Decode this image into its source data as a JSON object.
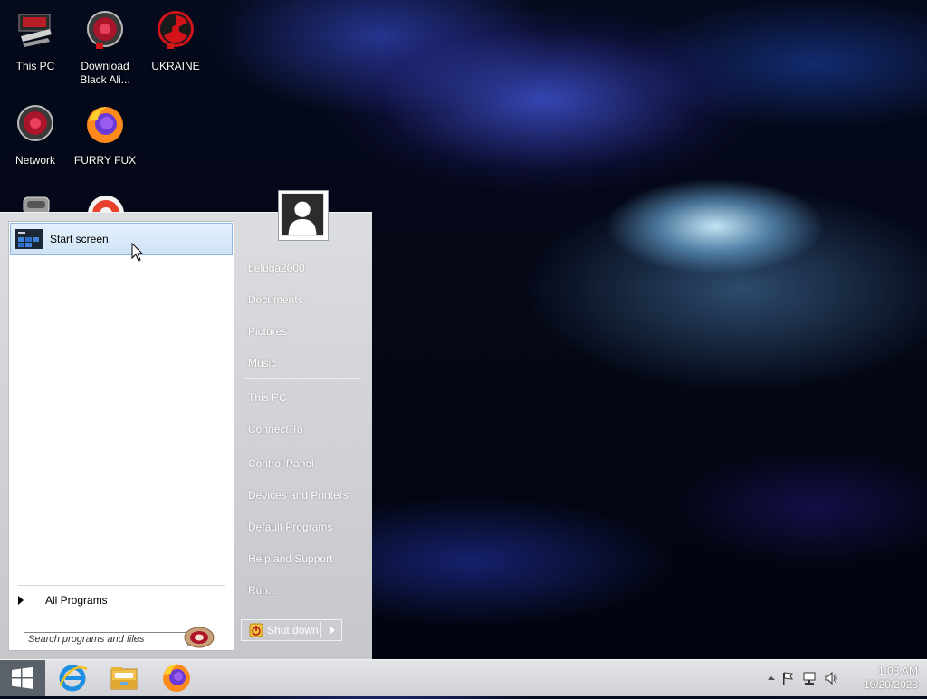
{
  "desktop": {
    "icons": [
      {
        "label": "This PC",
        "icon": "this-pc-icon"
      },
      {
        "label": "Download Black Ali...",
        "icon": "download-black-alien-icon"
      },
      {
        "label": "UKRAINE",
        "icon": "radiation-icon"
      },
      {
        "label": "Network",
        "icon": "network-icon"
      },
      {
        "label": "FURRY FUX",
        "icon": "firefox-icon"
      }
    ]
  },
  "start_menu": {
    "pinned": [
      {
        "label": "Start screen",
        "icon": "start-screen-icon"
      }
    ],
    "all_programs_label": "All Programs",
    "search_placeholder": "Search programs and files",
    "user_name": "beluga2000",
    "links": [
      {
        "label": "Documents"
      },
      {
        "label": "Pictures"
      },
      {
        "label": "Music"
      },
      {
        "label": "This PC"
      },
      {
        "label": "Connect To"
      },
      {
        "label": "Control Panel"
      },
      {
        "label": "Devices and Printers"
      },
      {
        "label": "Default Programs"
      },
      {
        "label": "Help and Support"
      },
      {
        "label": "Run..."
      }
    ],
    "shutdown_label": "Shut down"
  },
  "taskbar": {
    "apps": [
      {
        "icon": "internet-explorer-icon"
      },
      {
        "icon": "file-explorer-icon"
      },
      {
        "icon": "firefox-icon"
      }
    ],
    "tray_icons": [
      "show-hidden-icons-chevron-icon",
      "action-center-flag-icon",
      "network-icon",
      "volume-icon"
    ],
    "time": "1:03 AM",
    "date": "10/20/2023"
  }
}
